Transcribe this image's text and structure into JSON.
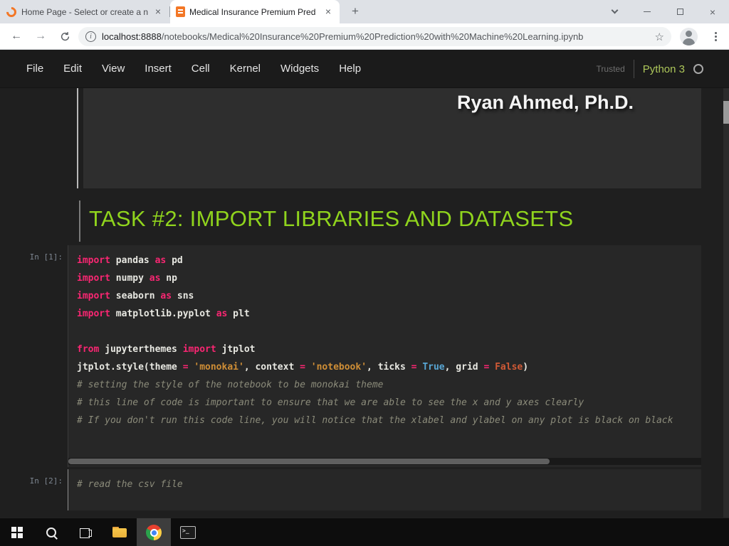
{
  "browser": {
    "tabs": [
      {
        "title": "Home Page - Select or create a n"
      },
      {
        "title": "Medical Insurance Premium Pred"
      }
    ],
    "new_tab": "+",
    "close_glyph": "×",
    "back_glyph": "←",
    "forward_glyph": "→",
    "info_glyph": "i",
    "star_glyph": "☆",
    "url_host": "localhost:8888",
    "url_path": "/notebooks/Medical%20Insurance%20Premium%20Prediction%20with%20Machine%20Learning.ipynb"
  },
  "jupyter": {
    "menu": [
      "File",
      "Edit",
      "View",
      "Insert",
      "Cell",
      "Kernel",
      "Widgets",
      "Help"
    ],
    "trusted_label": "Trusted",
    "kernel_name": "Python 3"
  },
  "notebook": {
    "banner_text": "Ryan Ahmed, Ph.D.",
    "section_heading": "TASK #2: IMPORT LIBRARIES AND DATASETS",
    "code_cells": [
      {
        "prompt": "In [1]:",
        "lines": [
          [
            [
              "kw",
              "import"
            ],
            [
              "pl",
              " pandas "
            ],
            [
              "kw",
              "as"
            ],
            [
              "pl",
              " pd"
            ]
          ],
          [
            [
              "kw",
              "import"
            ],
            [
              "pl",
              " numpy "
            ],
            [
              "kw",
              "as"
            ],
            [
              "pl",
              " np"
            ]
          ],
          [
            [
              "kw",
              "import"
            ],
            [
              "pl",
              " seaborn "
            ],
            [
              "kw",
              "as"
            ],
            [
              "pl",
              " sns"
            ]
          ],
          [
            [
              "kw",
              "import"
            ],
            [
              "pl",
              " matplotlib.pyplot "
            ],
            [
              "kw",
              "as"
            ],
            [
              "pl",
              " plt"
            ]
          ],
          [],
          [
            [
              "kw",
              "from"
            ],
            [
              "pl",
              " jupyterthemes "
            ],
            [
              "kw",
              "import"
            ],
            [
              "pl",
              " jtplot"
            ]
          ],
          [
            [
              "pl",
              "jtplot.style(theme "
            ],
            [
              "op",
              "="
            ],
            [
              "pl",
              " "
            ],
            [
              "st",
              "'monokai'"
            ],
            [
              "pl",
              ", context "
            ],
            [
              "op",
              "="
            ],
            [
              "pl",
              " "
            ],
            [
              "st",
              "'notebook'"
            ],
            [
              "pl",
              ", ticks "
            ],
            [
              "op",
              "="
            ],
            [
              "pl",
              " "
            ],
            [
              "bt",
              "True"
            ],
            [
              "pl",
              ", grid "
            ],
            [
              "op",
              "="
            ],
            [
              "pl",
              " "
            ],
            [
              "bf",
              "False"
            ],
            [
              "pl",
              ")"
            ]
          ],
          [
            [
              "cm",
              "# setting the style of the notebook to be monokai theme"
            ]
          ],
          [
            [
              "cm",
              "# this line of code is important to ensure that we are able to see the x and y axes clearly"
            ]
          ],
          [
            [
              "cm",
              "# If you don't run this code line, you will notice that the xlabel and ylabel on any plot is black on black"
            ]
          ]
        ]
      },
      {
        "prompt": "In [2]:",
        "lines": [
          [
            [
              "cm",
              "# read the csv file"
            ]
          ]
        ]
      }
    ]
  },
  "colors": {
    "heading_green": "#90d41d",
    "keyword_pink": "#f92672",
    "string_orange": "#cf8e36",
    "true_blue": "#58a6d4",
    "false_red": "#d05a36",
    "comment_gray": "#8b8b7a",
    "jupyter_orange": "#f37726"
  }
}
